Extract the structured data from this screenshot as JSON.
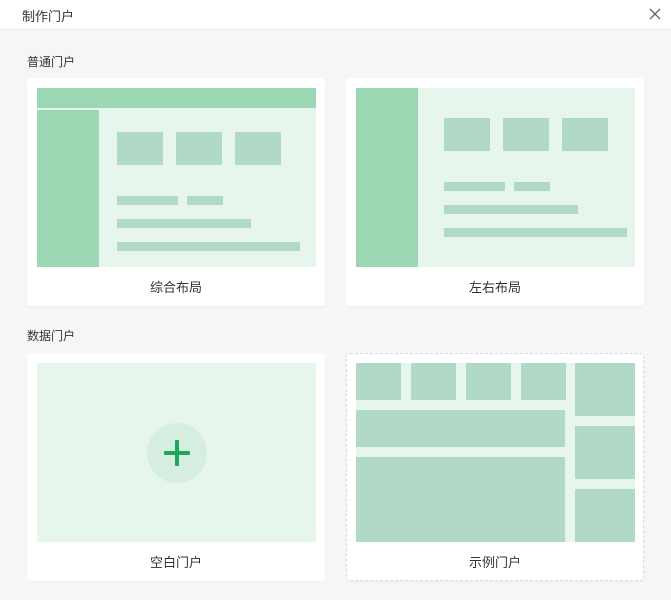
{
  "dialog": {
    "title": "制作门户"
  },
  "sections": {
    "normal": {
      "title": "普通门户",
      "cards": [
        {
          "label": "综合布局"
        },
        {
          "label": "左右布局"
        }
      ]
    },
    "data": {
      "title": "数据门户",
      "cards": [
        {
          "label": "空白门户"
        },
        {
          "label": "示例门户"
        }
      ]
    }
  },
  "icons": {
    "close": "close-icon",
    "add": "plus-icon"
  },
  "colors": {
    "preview_bg": "#e6f6ec",
    "block_strong": "#9dd8b4",
    "block_mid": "#b0dac5",
    "accent": "#22a45a"
  }
}
